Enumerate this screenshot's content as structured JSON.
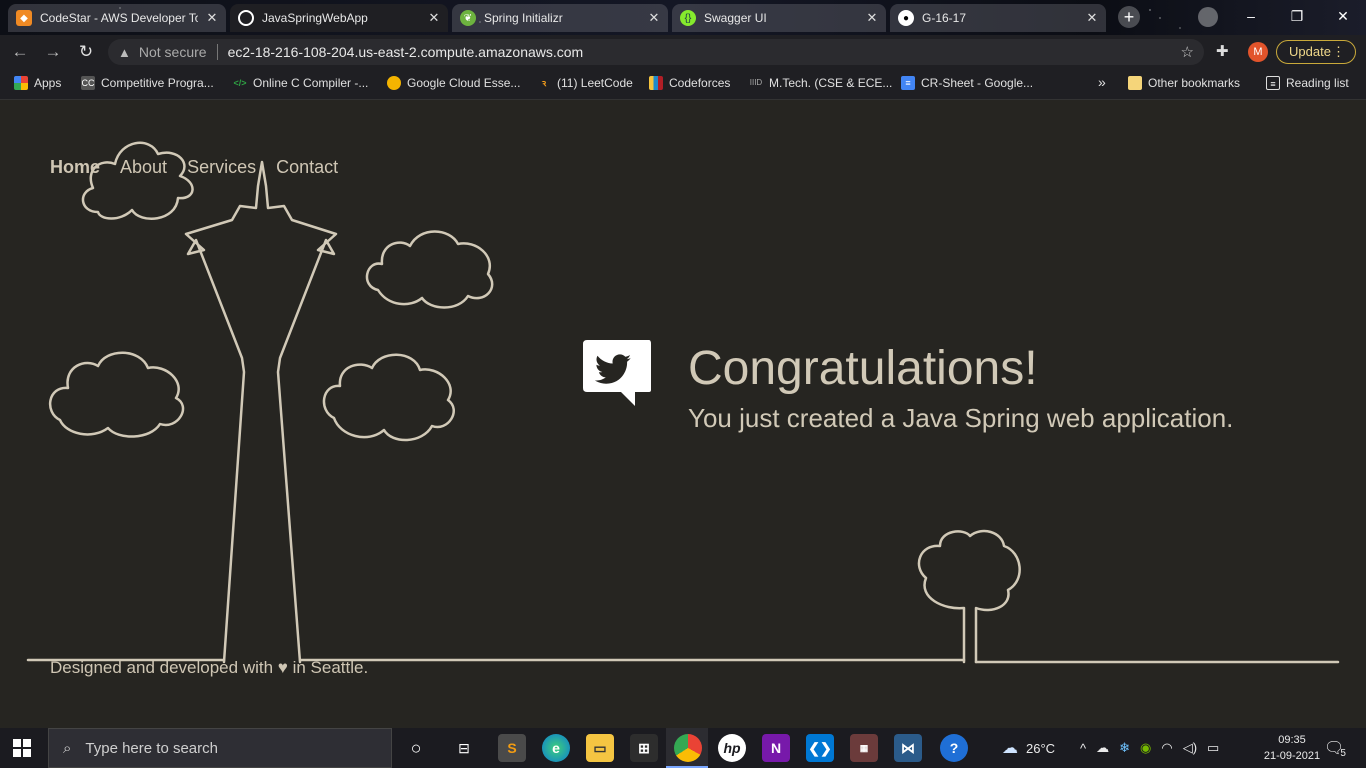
{
  "browser": {
    "tabs": [
      {
        "title": "CodeStar - AWS Developer To",
        "active": false
      },
      {
        "title": "JavaSpringWebApp",
        "active": true
      },
      {
        "title": "Spring Initializr",
        "active": false
      },
      {
        "title": "Swagger UI",
        "active": false
      },
      {
        "title": "G-16-17",
        "active": false
      }
    ],
    "new_tab_label": "+",
    "window_controls": [
      "–",
      "❐",
      "✕"
    ],
    "address": {
      "security_label": "Not secure",
      "url": "ec2-18-216-108-204.us-east-2.compute.amazonaws.com"
    },
    "profile_initial": "M",
    "update_label": "Update",
    "bookmarks": [
      {
        "label": "Apps",
        "icon": "apps-grid-icon",
        "color": "#e8a33d"
      },
      {
        "label": "Competitive Progra...",
        "icon": "cc-icon",
        "color": "#555555"
      },
      {
        "label": "Online C Compiler -...",
        "icon": "code-icon",
        "color": "#2ea043"
      },
      {
        "label": "Google Cloud Esse...",
        "icon": "qwiklabs-icon",
        "color": "#f4b400"
      },
      {
        "label": "(11) LeetCode",
        "icon": "leetcode-icon",
        "color": "#f89f1b"
      },
      {
        "label": "Codeforces",
        "icon": "codeforces-icon",
        "color": "#1f8acb"
      },
      {
        "label": "M.Tech. (CSE & ECE...",
        "icon": "iiitd-icon",
        "color": "#888888"
      },
      {
        "label": "CR-Sheet - Google...",
        "icon": "docs-icon",
        "color": "#4285f4"
      }
    ],
    "more_bookmarks": "»",
    "other_bookmarks": "Other bookmarks",
    "reading_list": "Reading list"
  },
  "page": {
    "nav": [
      "Home",
      "About",
      "Services",
      "Contact"
    ],
    "headline": "Congratulations!",
    "subline": "You just created a Java Spring web application.",
    "footer": "Designed and developed with ♥ in Seattle."
  },
  "taskbar": {
    "search_placeholder": "Type here to search",
    "weather": "26°C",
    "time": "09:35",
    "date": "21-09-2021",
    "notifications": "5"
  },
  "colors": {
    "page_bg": "#262521",
    "line": "#d1c9b7"
  }
}
